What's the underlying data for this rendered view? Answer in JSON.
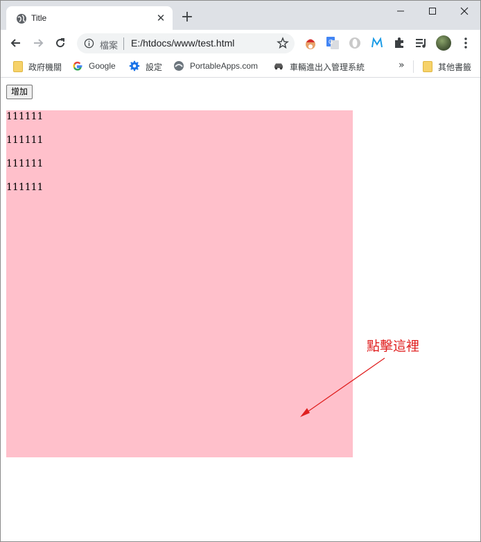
{
  "browser": {
    "tab_title": "Title",
    "security_label": "檔案",
    "url": "E:/htdocs/www/test.html"
  },
  "bookmarks": [
    {
      "label": "政府機關",
      "icon": "folder-icon"
    },
    {
      "label": "Google",
      "icon": "google-icon"
    },
    {
      "label": "設定",
      "icon": "gear-icon"
    },
    {
      "label": "PortableApps.com",
      "icon": "portableapps-icon"
    },
    {
      "label": "車輛進出入管理系統",
      "icon": "car-icon"
    }
  ],
  "other_bookmarks": "其他書籤",
  "page": {
    "add_button": "增加",
    "lines": [
      "111111",
      "111111",
      "111111",
      "111111"
    ],
    "annotation": "點擊這裡"
  },
  "colors": {
    "pink_box": "#ffc0cb",
    "annotation": "#e02020"
  }
}
